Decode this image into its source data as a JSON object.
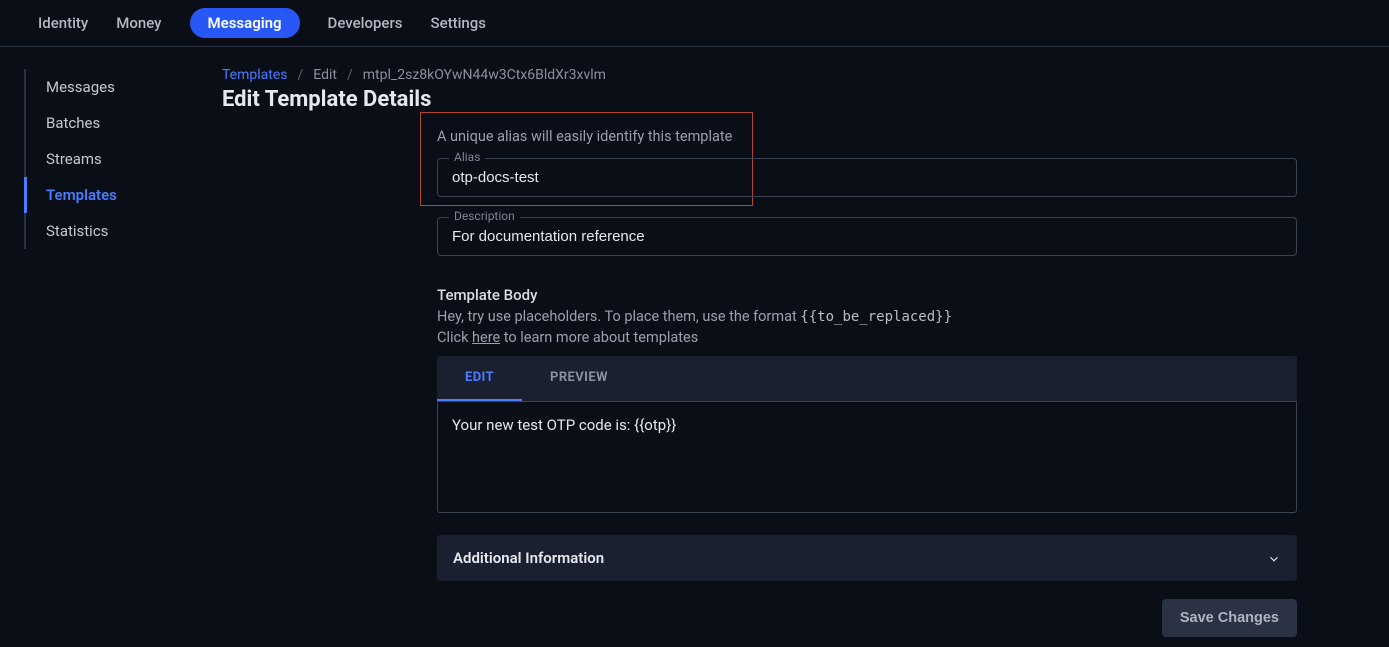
{
  "topnav": {
    "items": [
      {
        "label": "Identity",
        "active": false
      },
      {
        "label": "Money",
        "active": false
      },
      {
        "label": "Messaging",
        "active": true
      },
      {
        "label": "Developers",
        "active": false
      },
      {
        "label": "Settings",
        "active": false
      }
    ]
  },
  "sidebar": {
    "items": [
      {
        "label": "Messages",
        "active": false
      },
      {
        "label": "Batches",
        "active": false
      },
      {
        "label": "Streams",
        "active": false
      },
      {
        "label": "Templates",
        "active": true
      },
      {
        "label": "Statistics",
        "active": false
      }
    ]
  },
  "breadcrumb": {
    "root": "Templates",
    "action": "Edit",
    "id": "mtpl_2sz8kOYwN44w3Ctx6BldXr3xvlm"
  },
  "page": {
    "title": "Edit Template Details"
  },
  "form": {
    "alias_hint": "A unique alias will easily identify this template",
    "alias_label": "Alias",
    "alias_value": "otp-docs-test",
    "description_label": "Description",
    "description_value": "For documentation reference",
    "body_title": "Template Body",
    "body_hint_prefix": "Hey, try use placeholders. To place them, use the format ",
    "body_hint_code": "{{to_be_replaced}}",
    "body_hint_click": "Click ",
    "body_hint_here": "here",
    "body_hint_suffix": " to learn more about templates",
    "tabs": {
      "edit": "EDIT",
      "preview": "PREVIEW"
    },
    "body_value": "Your new test OTP code is: {{otp}}",
    "accordion_title": "Additional Information",
    "save_label": "Save Changes"
  }
}
